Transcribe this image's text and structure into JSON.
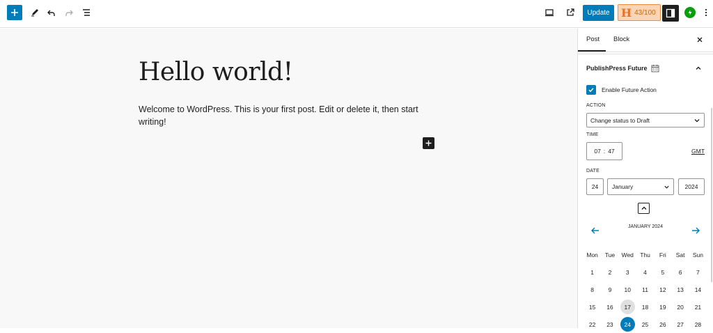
{
  "toolbar": {
    "update_label": "Update",
    "score_letter": "H",
    "score_label": "43/100"
  },
  "post": {
    "title": "Hello world!",
    "body": "Welcome to WordPress. This is your first post. Edit or delete it, then start writing!"
  },
  "sidebar": {
    "tabs": [
      "Post",
      "Block"
    ],
    "panel_title": "PublishPress Future",
    "enable_label": "Enable Future Action",
    "action_label": "ACTION",
    "action_value": "Change status to Draft",
    "time_label": "TIME",
    "time_hour": "07",
    "time_sep": ":",
    "time_minute": "47",
    "gmt_label": "GMT",
    "date_label": "DATE",
    "date_day": "24",
    "date_month": "January",
    "date_year": "2024"
  },
  "calendar": {
    "month_label": "JANUARY 2024",
    "weekdays": [
      "Mon",
      "Tue",
      "Wed",
      "Thu",
      "Fri",
      "Sat",
      "Sun"
    ],
    "weeks": [
      [
        "1",
        "2",
        "3",
        "4",
        "5",
        "6",
        "7"
      ],
      [
        "8",
        "9",
        "10",
        "11",
        "12",
        "13",
        "14"
      ],
      [
        "15",
        "16",
        "17",
        "18",
        "19",
        "20",
        "21"
      ],
      [
        "22",
        "23",
        "24",
        "25",
        "26",
        "27",
        "28"
      ]
    ],
    "today": "17",
    "selected": "24"
  },
  "colors": {
    "accent": "#007cba",
    "dark": "#1e1e1e",
    "score_bg": "#fbd5b4",
    "score_text": "#d26300",
    "jetpack": "#069e08"
  }
}
